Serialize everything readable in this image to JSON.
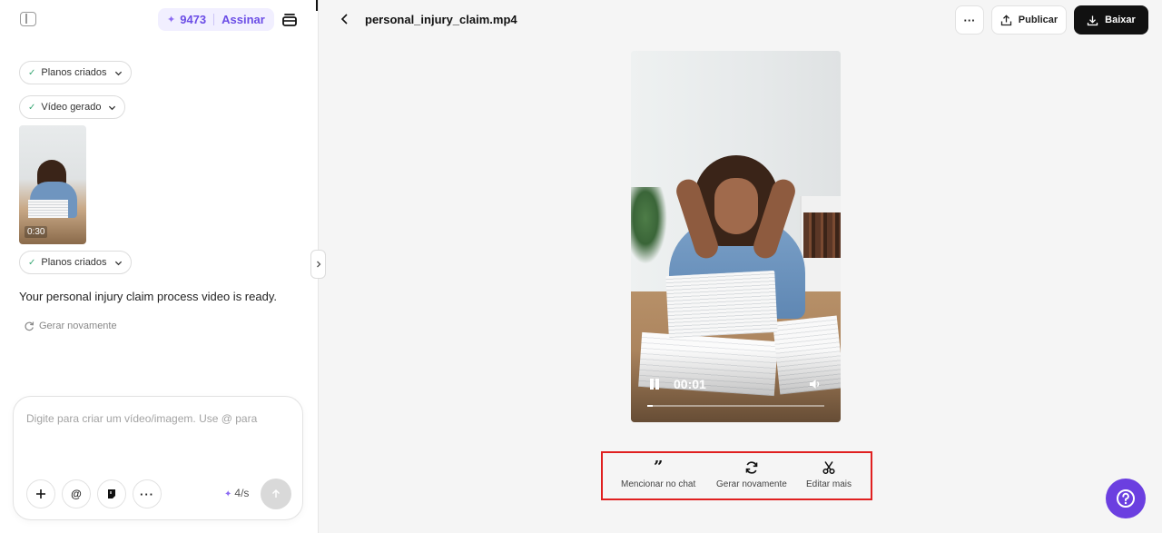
{
  "sidebar": {
    "credits": "9473",
    "subscribe_label": "Assinar",
    "steps": [
      {
        "label": "Planos criados"
      },
      {
        "label": "Vídeo gerado"
      },
      {
        "label": "Planos criados"
      }
    ],
    "thumbnail": {
      "duration": "0:30"
    },
    "ready_message": "Your personal injury claim process video is ready.",
    "regenerate_label": "Gerar novamente"
  },
  "composer": {
    "placeholder": "Digite para criar um vídeo/imagem. Use @ para",
    "rate": "4/s"
  },
  "header": {
    "file_title": "personal_injury_claim.mp4",
    "more_label": "···",
    "publish_label": "Publicar",
    "download_label": "Baixar"
  },
  "player": {
    "time": "00:01",
    "progress": 0.03
  },
  "actions": [
    {
      "label": "Mencionar no chat",
      "icon": "quote-icon"
    },
    {
      "label": "Gerar novamente",
      "icon": "refresh-icon"
    },
    {
      "label": "Editar mais",
      "icon": "scissors-icon"
    }
  ],
  "colors": {
    "accent": "#6b3fe0",
    "highlight_border": "#e02020",
    "check": "#3aa875"
  }
}
